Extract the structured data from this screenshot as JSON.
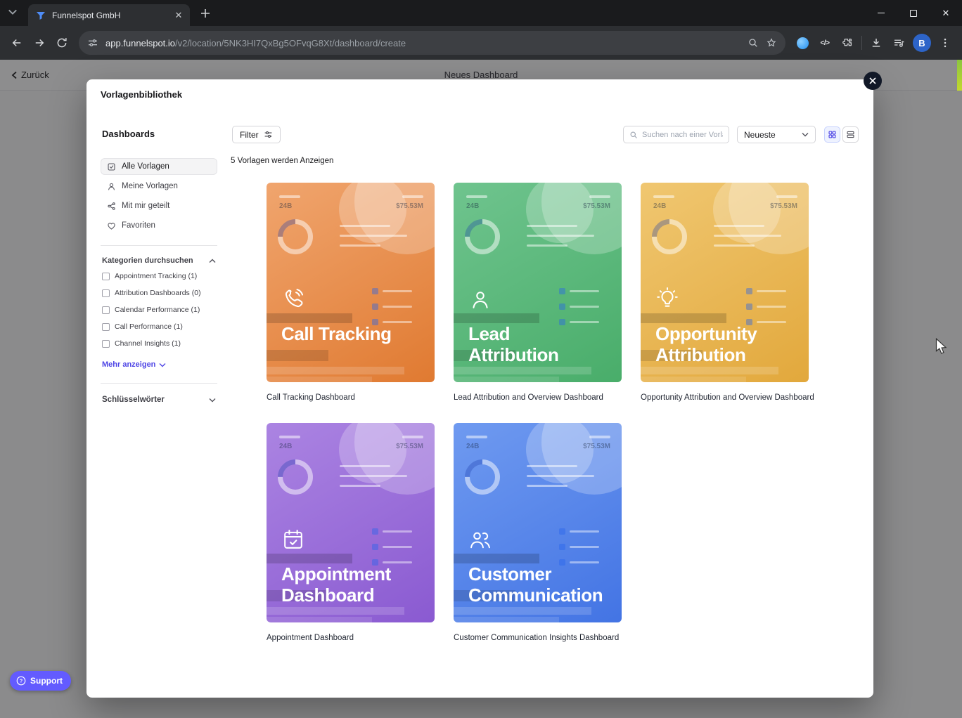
{
  "browser": {
    "tab_title": "Funnelspot GmbH",
    "url_domain": "app.funnelspot.io",
    "url_path": "/v2/location/5NK3HI7QxBg5OFvqG8Xt/dashboard/create",
    "profile_initial": "B"
  },
  "page": {
    "back_label": "Zurück",
    "title": "Neues Dashboard",
    "support_label": "Support"
  },
  "modal": {
    "title": "Vorlagenbibliothek",
    "sidebar": {
      "heading": "Dashboards",
      "items": [
        {
          "label": "Alle Vorlagen",
          "icon": "checkbox",
          "selected": true
        },
        {
          "label": "Meine Vorlagen",
          "icon": "person",
          "selected": false
        },
        {
          "label": "Mit mir geteilt",
          "icon": "share",
          "selected": false
        },
        {
          "label": "Favoriten",
          "icon": "heart",
          "selected": false
        }
      ],
      "categories_heading": "Kategorien durchsuchen",
      "categories": [
        "Appointment Tracking (1)",
        "Attribution Dashboards (0)",
        "Calendar Performance (1)",
        "Call Performance (1)",
        "Channel Insights (1)"
      ],
      "show_more_label": "Mehr anzeigen",
      "keywords_heading": "Schlüsselwörter"
    },
    "toolbar": {
      "filter_label": "Filter",
      "search_placeholder": "Suchen nach einer Vorlage",
      "sort_value": "Neueste",
      "active_view": "grid"
    },
    "results_count": "5 Vorlagen werden Anzeigen",
    "preview": {
      "stat_left": "24B",
      "stat_right": "$75.53M"
    },
    "templates": [
      {
        "title": "Call Tracking",
        "caption": "Call Tracking Dashboard",
        "icon": "phone",
        "gradient_from": "#f0a56e",
        "gradient_to": "#e07a31"
      },
      {
        "title": "Lead Attribution",
        "caption": "Lead Attribution and Overview Dashboard",
        "icon": "lead",
        "gradient_from": "#6fc48e",
        "gradient_to": "#49ad6a"
      },
      {
        "title": "Opportunity Attribution",
        "caption": "Opportunity Attribution and Overview Dashboard",
        "icon": "lightbulb",
        "gradient_from": "#f0c771",
        "gradient_to": "#e2a83c"
      },
      {
        "title": "Appointment Dashboard",
        "caption": "Appointment Dashboard",
        "icon": "calendar",
        "gradient_from": "#ab84e2",
        "gradient_to": "#8a5ad1"
      },
      {
        "title": "Customer Communication",
        "caption": "Customer Communication Insights Dashboard",
        "icon": "people",
        "gradient_from": "#6f9af0",
        "gradient_to": "#4374e4"
      }
    ]
  }
}
